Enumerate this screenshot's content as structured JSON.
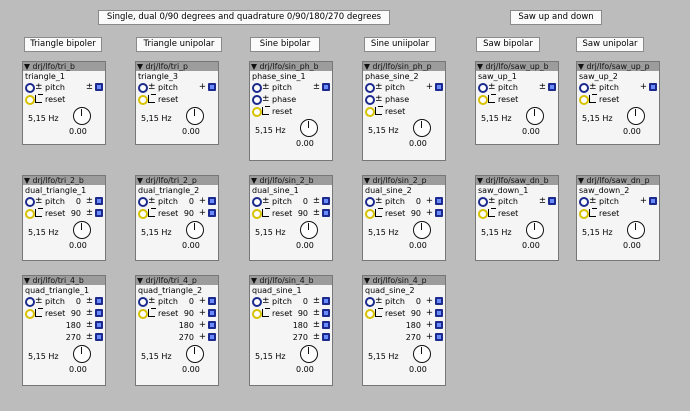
{
  "header": {
    "title_main": "Single, dual 0/90 degrees and quadrature 0/90/180/270 degrees",
    "title_saw": "Saw up and down"
  },
  "columns": {
    "tri_b": "Triangle bipoler",
    "tri_p": "Triangle unipolar",
    "sin_b": "Sine bipolar",
    "sin_p": "Sine uniipolar",
    "saw_b": "Saw bipolar",
    "saw_p": "Saw unipolar"
  },
  "objects": {
    "o1": {
      "header": "▼ drj/lfo/tri_b",
      "name": "triangle_1",
      "pitch": "pitch",
      "pitch_mark": "±",
      "reset": "reset",
      "freq": "5,15 Hz",
      "knob": "0.00"
    },
    "o2": {
      "header": "▼ drj/lfo/tri_p",
      "name": "triangle_3",
      "pitch": "pitch",
      "pitch_mark": "+",
      "reset": "reset",
      "freq": "5,15 Hz",
      "knob": "0.00"
    },
    "o3": {
      "header": "▼ drj/lfo/sin_ph_b",
      "name": "phase_sine_1",
      "pitch": "pitch",
      "pitch_mark": "±",
      "phase": "phase",
      "reset": "reset",
      "freq": "5,15 Hz",
      "knob": "0.00"
    },
    "o4": {
      "header": "▼ drj/lfo/sin_ph_p",
      "name": "phase_sine_2",
      "pitch": "pitch",
      "pitch_mark": "+",
      "phase": "phase",
      "reset": "reset",
      "freq": "5,15 Hz",
      "knob": "0.00"
    },
    "o5": {
      "header": "▼ drj/lfo/saw_up_b",
      "name": "saw_up_1",
      "pitch": "pitch",
      "pitch_mark": "±",
      "reset": "reset",
      "freq": "5,15 Hz",
      "knob": "0.00"
    },
    "o6": {
      "header": "▼ drj/lfo/saw_up_p",
      "name": "saw_up_2",
      "pitch": "pitch",
      "pitch_mark": "+",
      "reset": "reset",
      "freq": "5,15 Hz",
      "knob": "0.00"
    },
    "o7": {
      "header": "▼ drj/lfo/tri_2_b",
      "name": "dual_triangle_1",
      "pitch": "pitch",
      "reset": "reset",
      "v0": "0",
      "m0": "±",
      "v90": "90",
      "m90": "±",
      "freq": "5,15 Hz",
      "knob": "0.00"
    },
    "o8": {
      "header": "▼ drj/lfo/tri_2_p",
      "name": "dual_triangle_2",
      "pitch": "pitch",
      "reset": "reset",
      "v0": "0",
      "m0": "+",
      "v90": "90",
      "m90": "+",
      "freq": "5,15 Hz",
      "knob": "0.00"
    },
    "o9": {
      "header": "▼ drj/lfo/sin_2_b",
      "name": "dual_sine_1",
      "pitch": "pitch",
      "reset": "reset",
      "v0": "0",
      "m0": "±",
      "v90": "90",
      "m90": "±",
      "freq": "5,15 Hz",
      "knob": "0.00"
    },
    "o10": {
      "header": "▼ drj/lfo/sin_2_p",
      "name": "dual_sine_2",
      "pitch": "pitch",
      "reset": "reset",
      "v0": "0",
      "m0": "+",
      "v90": "90",
      "m90": "+",
      "freq": "5,15 Hz",
      "knob": "0.00"
    },
    "o11": {
      "header": "▼ drj/lfo/saw_dn_b",
      "name": "saw_down_1",
      "pitch": "pitch",
      "pitch_mark": "±",
      "reset": "reset",
      "freq": "5,15 Hz",
      "knob": "0.00"
    },
    "o12": {
      "header": "▼ drj/lfo/saw_dn_p",
      "name": "saw_down_2",
      "pitch": "pitch",
      "pitch_mark": "+",
      "reset": "reset",
      "freq": "5,15 Hz",
      "knob": "0.00"
    },
    "o13": {
      "header": "▼ drj/lfo/tri_4_b",
      "name": "quad_triangle_1",
      "pitch": "pitch",
      "reset": "reset",
      "v0": "0",
      "m0": "±",
      "v90": "90",
      "m90": "±",
      "v180": "180",
      "m180": "±",
      "v270": "270",
      "m270": "±",
      "freq": "5,15 Hz",
      "knob": "0.00"
    },
    "o14": {
      "header": "▼ drj/lfo/tri_4_p",
      "name": "quad_triangle_2",
      "pitch": "pitch",
      "reset": "reset",
      "v0": "0",
      "m0": "+",
      "v90": "90",
      "m90": "+",
      "v180": "180",
      "m180": "+",
      "v270": "270",
      "m270": "+",
      "freq": "5,15 Hz",
      "knob": "0.00"
    },
    "o15": {
      "header": "▼ drj/lfo/sin_4_b",
      "name": "quad_sine_1",
      "pitch": "pitch",
      "reset": "reset",
      "v0": "0",
      "m0": "±",
      "v90": "90",
      "m90": "±",
      "v180": "180",
      "m180": "±",
      "v270": "270",
      "m270": "±",
      "freq": "5,15 Hz",
      "knob": "0.00"
    },
    "o16": {
      "header": "▼ drj/lfo/sin_4_p",
      "name": "quad_sine_2",
      "pitch": "pitch",
      "reset": "reset",
      "v0": "0",
      "m0": "+",
      "v90": "90",
      "m90": "+",
      "v180": "180",
      "m180": "+",
      "v270": "270",
      "m270": "+",
      "freq": "5,15 Hz",
      "knob": "0.00"
    }
  },
  "symbols": {
    "bipolar": "±",
    "unipolar": "+"
  },
  "colors": {
    "background": "#bcbcbc",
    "object": "#f5f5f5",
    "header": "#9c9c9c",
    "inlet_blue": "#1b2a8c",
    "inlet_yellow": "#d7c200"
  }
}
